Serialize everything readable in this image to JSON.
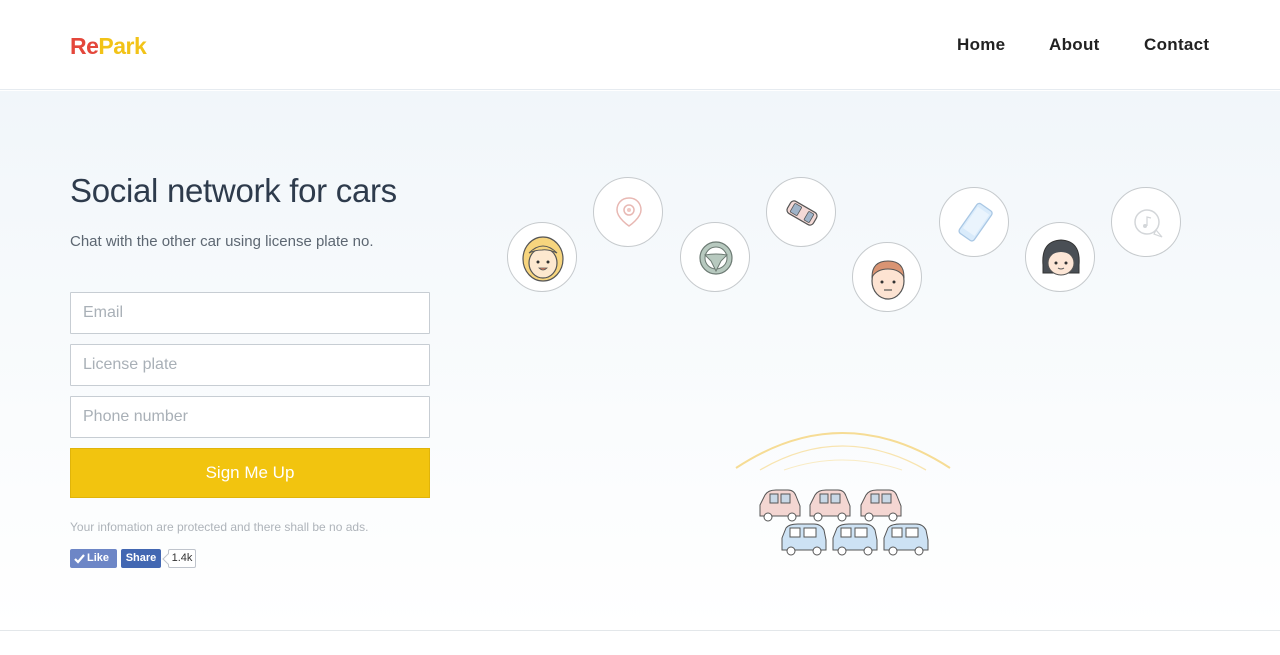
{
  "header": {
    "logo": {
      "part1": "Re",
      "part2": "Park"
    },
    "nav": [
      {
        "label": "Home"
      },
      {
        "label": "About"
      },
      {
        "label": "Contact"
      }
    ]
  },
  "hero": {
    "title": "Social network for cars",
    "subtitle": "Chat with the other car using license plate no.",
    "form": {
      "email_placeholder": "Email",
      "plate_placeholder": "License plate",
      "phone_placeholder": "Phone number",
      "submit_label": "Sign Me Up"
    },
    "note": "Your infomation are protected and there shall be no ads.",
    "facebook": {
      "like_label": "Like",
      "share_label": "Share",
      "count": "1.4k"
    }
  },
  "illustration": {
    "bubbles": [
      "woman-avatar-icon",
      "location-pin-icon",
      "steering-wheel-icon",
      "car-icon",
      "man-avatar-icon",
      "phone-icon",
      "girl-avatar-icon",
      "chat-music-icon"
    ],
    "colors": {
      "accent": "#f2c40f",
      "car_pink": "#f4d7d3",
      "car_blue": "#cfe3f4"
    }
  },
  "colors": {
    "brand_red": "#e4473b",
    "brand_yellow": "#f2c318",
    "button": "#f2c40f"
  }
}
